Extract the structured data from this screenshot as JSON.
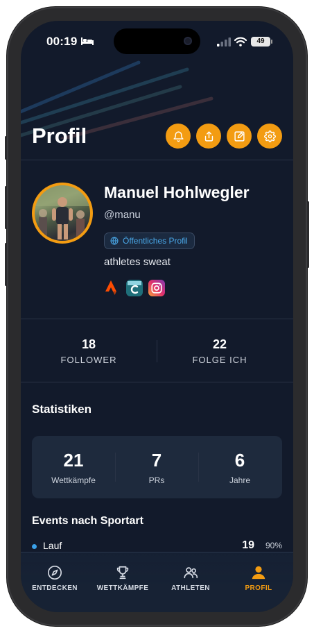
{
  "status_bar": {
    "time": "00:19",
    "battery": "49"
  },
  "header": {
    "title": "Profil"
  },
  "header_buttons": [
    "bell-icon",
    "share-icon",
    "edit-icon",
    "gear-icon"
  ],
  "profile": {
    "name": "Manuel Hohlwegler",
    "handle": "@manu",
    "visibility_badge": "Öffentliches Profil",
    "bio": "athletes sweat",
    "social_links": [
      "strava-icon",
      "c-app-icon",
      "instagram-icon"
    ]
  },
  "follow": {
    "followers": {
      "count": "18",
      "label": "FOLLOWER"
    },
    "following": {
      "count": "22",
      "label": "FOLGE ICH"
    }
  },
  "stats": {
    "title": "Statistiken",
    "items": [
      {
        "value": "21",
        "label": "Wettkämpfe"
      },
      {
        "value": "7",
        "label": "PRs"
      },
      {
        "value": "6",
        "label": "Jahre"
      }
    ]
  },
  "events": {
    "title": "Events nach Sportart",
    "rows": [
      {
        "label": "Lauf",
        "count": "19",
        "percent": "90%"
      }
    ]
  },
  "tabs": [
    {
      "label": "ENTDECKEN",
      "icon": "compass-icon",
      "active": false
    },
    {
      "label": "WETTKÄMPFE",
      "icon": "trophy-icon",
      "active": false
    },
    {
      "label": "ATHLETEN",
      "icon": "people-icon",
      "active": false
    },
    {
      "label": "PROFIL",
      "icon": "person-icon",
      "active": true
    }
  ],
  "colors": {
    "accent": "#f39c12",
    "background": "#121a2b",
    "card": "#1e2a3d",
    "link": "#4aa8e8"
  }
}
